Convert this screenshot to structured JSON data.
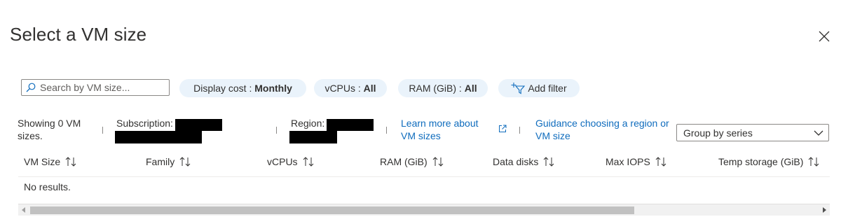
{
  "dialog": {
    "title": "Select a VM size",
    "close_icon": "close-icon"
  },
  "toolbar": {
    "search_placeholder": "Search by VM size...",
    "display_cost_label": "Display cost :",
    "display_cost_value": "Monthly",
    "vcpus_label": "vCPUs :",
    "vcpus_value": "All",
    "ram_label": "RAM (GiB) :",
    "ram_value": "All",
    "add_filter_label": "Add filter",
    "add_filter_icon": "add-filter-icon"
  },
  "info": {
    "showing_line1": "Showing 0 VM",
    "showing_line2": "sizes.",
    "subscription_label": "Subscription:",
    "region_label": "Region:",
    "learn_more_line1": "Learn more about",
    "learn_more_line2": "VM sizes",
    "external_link_icon": "external-link-icon",
    "guidance_line1": "Guidance choosing a region or",
    "guidance_line2": "VM size",
    "group_by_value": "Group by series"
  },
  "table": {
    "columns": [
      "VM Size",
      "Family",
      "vCPUs",
      "RAM (GiB)",
      "Data disks",
      "Max IOPS",
      "Temp storage (GiB)"
    ],
    "empty_text": "No results."
  },
  "colors": {
    "link": "#0f6cbd",
    "pill_bg": "#eaf3fb",
    "text": "#323130"
  }
}
